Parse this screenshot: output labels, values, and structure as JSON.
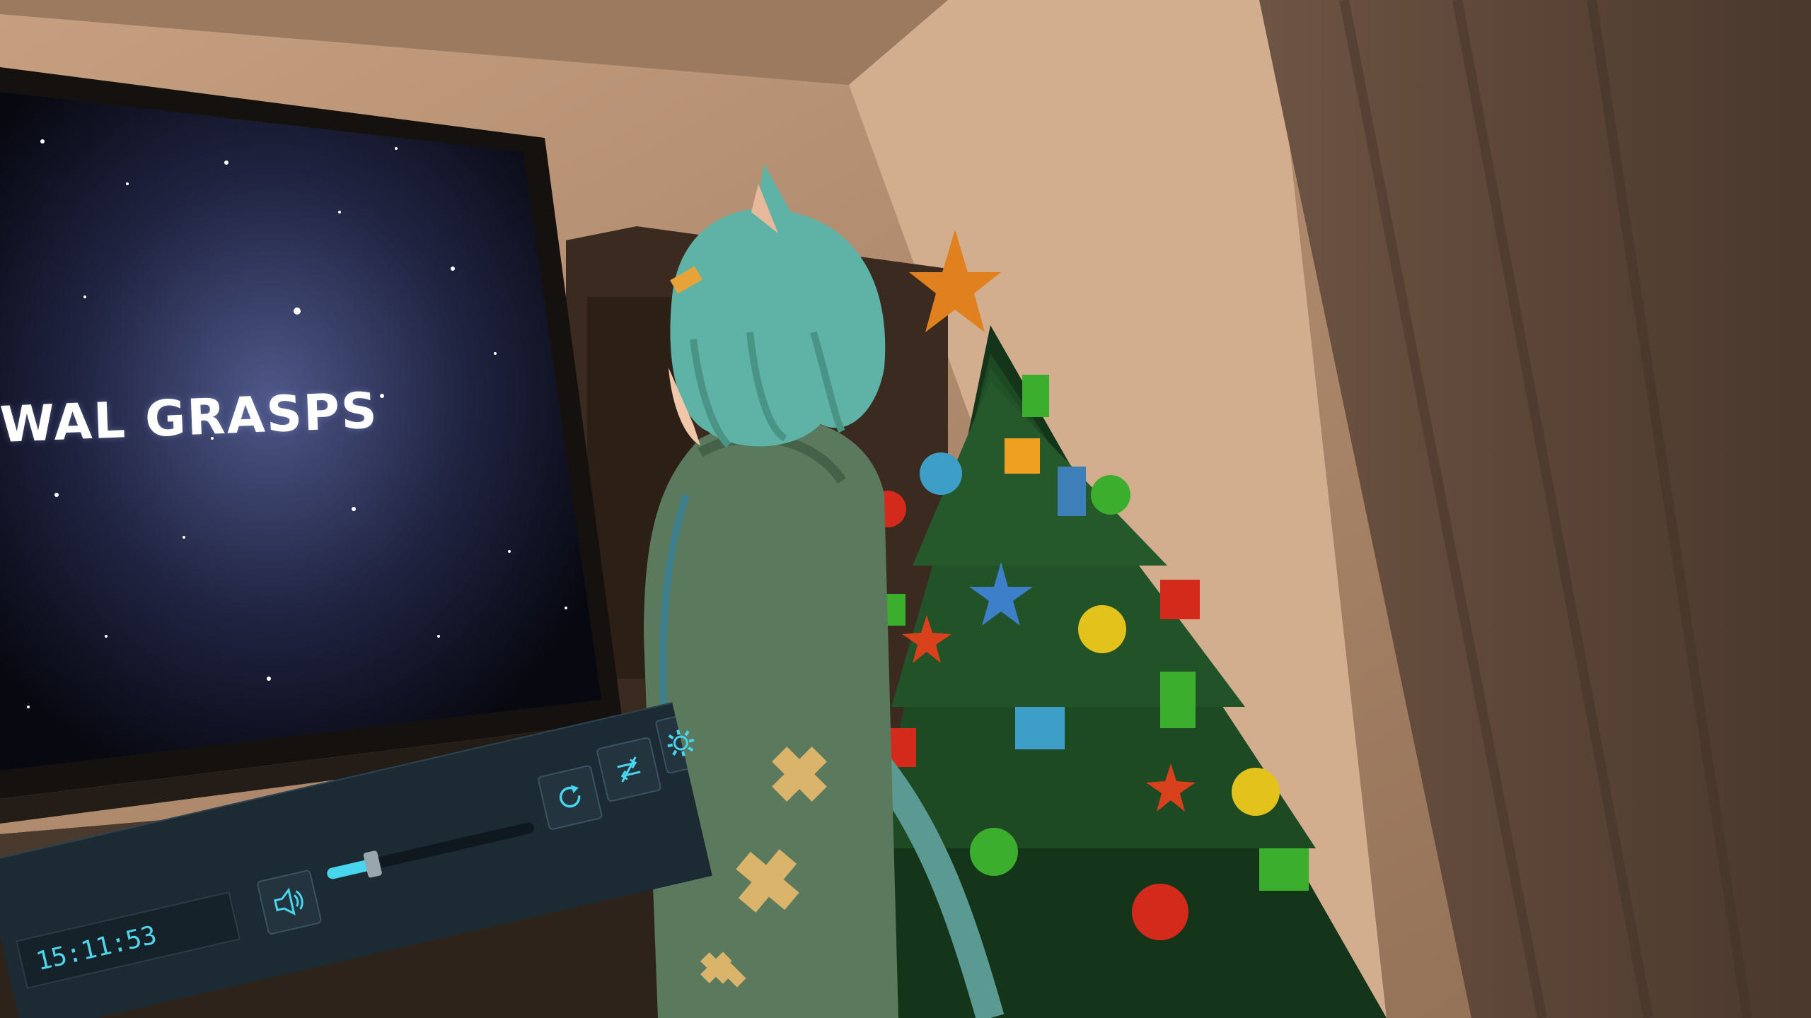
{
  "screen": {
    "title_text": "WAL GRASPS"
  },
  "player": {
    "time_text": "15:11:53",
    "volume_level": 0.22,
    "buttons": [
      {
        "name": "volume-button",
        "icon": "speaker-icon"
      },
      {
        "name": "reload-button",
        "icon": "reload-icon"
      },
      {
        "name": "resync-button",
        "icon": "resync-icon"
      },
      {
        "name": "settings-button",
        "icon": "gear-icon"
      }
    ]
  },
  "colors": {
    "ui_accent": "#48d6ef",
    "ui_panel": "#1c2a34",
    "wall": "#b08c6c",
    "tree": "#173a1e",
    "hair": "#5fb3a6",
    "hoodie": "#5b7a5d"
  }
}
